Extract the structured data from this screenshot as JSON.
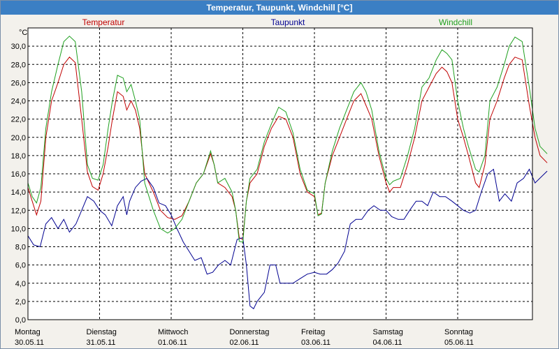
{
  "window": {
    "title": "Temperatur, Taupunkt, Windchill [°C]"
  },
  "chart_data": {
    "type": "line",
    "title": "Temperatur, Taupunkt, Windchill [°C]",
    "ylabel": "°C",
    "ylim": [
      0,
      32
    ],
    "yticks": [
      "0,0",
      "2,0",
      "4,0",
      "6,0",
      "8,0",
      "10,0",
      "12,0",
      "14,0",
      "16,0",
      "18,0",
      "20,0",
      "22,0",
      "24,0",
      "26,0",
      "28,0",
      "30,0"
    ],
    "xlim": [
      0,
      7
    ],
    "x_ticks": [
      {
        "day": "Montag",
        "date": "30.05.11",
        "x": 0
      },
      {
        "day": "Dienstag",
        "date": "31.05.11",
        "x": 1
      },
      {
        "day": "Mittwoch",
        "date": "01.06.11",
        "x": 2
      },
      {
        "day": "Donnerstag",
        "date": "02.06.11",
        "x": 3
      },
      {
        "day": "Freitag",
        "date": "03.06.11",
        "x": 4
      },
      {
        "day": "Samstag",
        "date": "04.06.11",
        "x": 5
      },
      {
        "day": "Sonntag",
        "date": "05.06.11",
        "x": 6
      }
    ],
    "grid": true,
    "legend_position": "top",
    "series": [
      {
        "name": "Temperatur",
        "color": "#c00000",
        "points": [
          [
            0,
            14.5
          ],
          [
            0.06,
            13.0
          ],
          [
            0.12,
            11.5
          ],
          [
            0.18,
            13.0
          ],
          [
            0.25,
            20
          ],
          [
            0.33,
            24
          ],
          [
            0.42,
            26
          ],
          [
            0.5,
            28
          ],
          [
            0.58,
            28.8
          ],
          [
            0.66,
            28.2
          ],
          [
            0.75,
            22
          ],
          [
            0.83,
            16.2
          ],
          [
            0.9,
            14.6
          ],
          [
            0.98,
            14.2
          ],
          [
            1.05,
            16
          ],
          [
            1.12,
            19
          ],
          [
            1.18,
            22
          ],
          [
            1.25,
            25
          ],
          [
            1.33,
            24.5
          ],
          [
            1.38,
            23
          ],
          [
            1.44,
            24
          ],
          [
            1.5,
            23
          ],
          [
            1.56,
            21
          ],
          [
            1.63,
            16
          ],
          [
            1.75,
            14
          ],
          [
            1.85,
            12
          ],
          [
            1.95,
            11.2
          ],
          [
            2.05,
            11
          ],
          [
            2.15,
            11.4
          ],
          [
            2.25,
            13
          ],
          [
            2.35,
            15
          ],
          [
            2.45,
            16
          ],
          [
            2.55,
            18.2
          ],
          [
            2.6,
            17
          ],
          [
            2.65,
            15
          ],
          [
            2.75,
            14.5
          ],
          [
            2.85,
            13.5
          ],
          [
            2.9,
            12
          ],
          [
            2.95,
            9.0
          ],
          [
            3.0,
            8.8
          ],
          [
            3.05,
            13
          ],
          [
            3.1,
            15
          ],
          [
            3.2,
            16
          ],
          [
            3.3,
            19
          ],
          [
            3.4,
            21
          ],
          [
            3.5,
            22.3
          ],
          [
            3.6,
            22
          ],
          [
            3.7,
            20
          ],
          [
            3.8,
            16
          ],
          [
            3.9,
            14
          ],
          [
            4.0,
            13.5
          ],
          [
            4.05,
            11.5
          ],
          [
            4.1,
            11.7
          ],
          [
            4.15,
            15
          ],
          [
            4.25,
            18
          ],
          [
            4.35,
            20
          ],
          [
            4.45,
            22
          ],
          [
            4.55,
            24
          ],
          [
            4.65,
            24.8
          ],
          [
            4.72,
            23.5
          ],
          [
            4.8,
            22
          ],
          [
            4.9,
            18
          ],
          [
            5.0,
            15
          ],
          [
            5.05,
            14
          ],
          [
            5.1,
            14.5
          ],
          [
            5.2,
            14.5
          ],
          [
            5.3,
            17
          ],
          [
            5.4,
            20
          ],
          [
            5.5,
            24
          ],
          [
            5.6,
            25.5
          ],
          [
            5.7,
            27
          ],
          [
            5.78,
            27.7
          ],
          [
            5.85,
            27.2
          ],
          [
            5.92,
            26
          ],
          [
            6.0,
            22
          ],
          [
            6.08,
            20
          ],
          [
            6.15,
            18
          ],
          [
            6.25,
            15
          ],
          [
            6.3,
            14.5
          ],
          [
            6.38,
            17
          ],
          [
            6.45,
            22
          ],
          [
            6.55,
            24
          ],
          [
            6.65,
            26.5
          ],
          [
            6.72,
            28
          ],
          [
            6.8,
            28.8
          ],
          [
            6.9,
            28.5
          ],
          [
            7.0,
            23.5
          ],
          [
            7.08,
            20
          ],
          [
            7.15,
            18
          ],
          [
            7.25,
            17.2
          ]
        ]
      },
      {
        "name": "Taupunkt",
        "color": "#000090",
        "points": [
          [
            0,
            9.2
          ],
          [
            0.08,
            8.2
          ],
          [
            0.17,
            8.0
          ],
          [
            0.25,
            10.5
          ],
          [
            0.33,
            11.2
          ],
          [
            0.42,
            10.0
          ],
          [
            0.5,
            11.0
          ],
          [
            0.58,
            9.6
          ],
          [
            0.67,
            10.5
          ],
          [
            0.75,
            12.0
          ],
          [
            0.83,
            13.5
          ],
          [
            0.92,
            13.0
          ],
          [
            1.0,
            12.0
          ],
          [
            1.08,
            11.5
          ],
          [
            1.17,
            10.3
          ],
          [
            1.25,
            12.5
          ],
          [
            1.33,
            13.5
          ],
          [
            1.38,
            11.5
          ],
          [
            1.42,
            13.0
          ],
          [
            1.5,
            14.5
          ],
          [
            1.58,
            15.2
          ],
          [
            1.66,
            15.5
          ],
          [
            1.75,
            14.5
          ],
          [
            1.83,
            12.8
          ],
          [
            1.92,
            12.5
          ],
          [
            2.0,
            11.5
          ],
          [
            2.08,
            10.0
          ],
          [
            2.17,
            8.5
          ],
          [
            2.25,
            7.5
          ],
          [
            2.33,
            6.5
          ],
          [
            2.42,
            6.8
          ],
          [
            2.5,
            5.0
          ],
          [
            2.58,
            5.2
          ],
          [
            2.66,
            6.0
          ],
          [
            2.75,
            6.5
          ],
          [
            2.83,
            6.0
          ],
          [
            2.92,
            8.8
          ],
          [
            3.0,
            9.0
          ],
          [
            3.05,
            6.0
          ],
          [
            3.1,
            1.5
          ],
          [
            3.15,
            1.2
          ],
          [
            3.2,
            2.0
          ],
          [
            3.3,
            3.0
          ],
          [
            3.38,
            6.0
          ],
          [
            3.46,
            6.0
          ],
          [
            3.52,
            4.0
          ],
          [
            3.6,
            4.0
          ],
          [
            3.7,
            4.0
          ],
          [
            3.8,
            4.5
          ],
          [
            3.9,
            5.0
          ],
          [
            4.0,
            5.2
          ],
          [
            4.08,
            5.0
          ],
          [
            4.17,
            5.0
          ],
          [
            4.25,
            5.5
          ],
          [
            4.33,
            6.2
          ],
          [
            4.42,
            7.5
          ],
          [
            4.5,
            10.5
          ],
          [
            4.58,
            11.0
          ],
          [
            4.66,
            11.0
          ],
          [
            4.75,
            12.0
          ],
          [
            4.83,
            12.5
          ],
          [
            4.92,
            12.0
          ],
          [
            5.0,
            12.0
          ],
          [
            5.08,
            11.3
          ],
          [
            5.17,
            11.0
          ],
          [
            5.25,
            11.0
          ],
          [
            5.33,
            12.0
          ],
          [
            5.42,
            13.0
          ],
          [
            5.5,
            13.0
          ],
          [
            5.58,
            12.5
          ],
          [
            5.66,
            14.0
          ],
          [
            5.75,
            13.5
          ],
          [
            5.83,
            13.5
          ],
          [
            5.92,
            13.0
          ],
          [
            6.0,
            12.5
          ],
          [
            6.08,
            12.0
          ],
          [
            6.17,
            11.7
          ],
          [
            6.25,
            12.0
          ],
          [
            6.33,
            14.0
          ],
          [
            6.42,
            16.0
          ],
          [
            6.5,
            16.5
          ],
          [
            6.58,
            13.0
          ],
          [
            6.66,
            13.8
          ],
          [
            6.75,
            13.0
          ],
          [
            6.83,
            15.0
          ],
          [
            6.92,
            15.5
          ],
          [
            7.0,
            16.5
          ],
          [
            7.08,
            15.0
          ],
          [
            7.25,
            16.3
          ]
        ]
      },
      {
        "name": "Windchill",
        "color": "#20a020",
        "points": [
          [
            0,
            15.0
          ],
          [
            0.06,
            13.5
          ],
          [
            0.12,
            12.8
          ],
          [
            0.18,
            14.5
          ],
          [
            0.25,
            21
          ],
          [
            0.33,
            25
          ],
          [
            0.42,
            28
          ],
          [
            0.5,
            30.5
          ],
          [
            0.58,
            31.1
          ],
          [
            0.66,
            30.5
          ],
          [
            0.75,
            25
          ],
          [
            0.83,
            17
          ],
          [
            0.9,
            15.5
          ],
          [
            0.98,
            15.3
          ],
          [
            1.05,
            17
          ],
          [
            1.12,
            21
          ],
          [
            1.18,
            24
          ],
          [
            1.25,
            26.8
          ],
          [
            1.33,
            26.5
          ],
          [
            1.38,
            25
          ],
          [
            1.44,
            25.8
          ],
          [
            1.5,
            24
          ],
          [
            1.56,
            22
          ],
          [
            1.63,
            15
          ],
          [
            1.75,
            12
          ],
          [
            1.85,
            10
          ],
          [
            1.95,
            9.5
          ],
          [
            2.05,
            10
          ],
          [
            2.15,
            11
          ],
          [
            2.25,
            13
          ],
          [
            2.35,
            15
          ],
          [
            2.45,
            16
          ],
          [
            2.55,
            18.5
          ],
          [
            2.6,
            17
          ],
          [
            2.65,
            15
          ],
          [
            2.75,
            15.5
          ],
          [
            2.85,
            14
          ],
          [
            2.9,
            12
          ],
          [
            2.95,
            8.6
          ],
          [
            3.0,
            8.5
          ],
          [
            3.05,
            13
          ],
          [
            3.1,
            15.5
          ],
          [
            3.2,
            16.5
          ],
          [
            3.3,
            19.5
          ],
          [
            3.4,
            21.5
          ],
          [
            3.5,
            23.3
          ],
          [
            3.6,
            22.8
          ],
          [
            3.7,
            20.5
          ],
          [
            3.8,
            16.5
          ],
          [
            3.9,
            14.2
          ],
          [
            4.0,
            13.8
          ],
          [
            4.05,
            11.4
          ],
          [
            4.1,
            11.6
          ],
          [
            4.15,
            15
          ],
          [
            4.25,
            18.5
          ],
          [
            4.35,
            21
          ],
          [
            4.45,
            23
          ],
          [
            4.55,
            25
          ],
          [
            4.65,
            26
          ],
          [
            4.72,
            25
          ],
          [
            4.8,
            23
          ],
          [
            4.9,
            18.5
          ],
          [
            5.0,
            15.5
          ],
          [
            5.05,
            14.8
          ],
          [
            5.1,
            15.2
          ],
          [
            5.2,
            15.5
          ],
          [
            5.3,
            18
          ],
          [
            5.4,
            21
          ],
          [
            5.5,
            25.5
          ],
          [
            5.6,
            26.5
          ],
          [
            5.7,
            28.5
          ],
          [
            5.78,
            29.6
          ],
          [
            5.85,
            29.2
          ],
          [
            5.92,
            28.5
          ],
          [
            6.0,
            24
          ],
          [
            6.08,
            21
          ],
          [
            6.15,
            19
          ],
          [
            6.25,
            16.5
          ],
          [
            6.3,
            16.2
          ],
          [
            6.38,
            18
          ],
          [
            6.45,
            24
          ],
          [
            6.55,
            25.5
          ],
          [
            6.65,
            28
          ],
          [
            6.72,
            30
          ],
          [
            6.8,
            31
          ],
          [
            6.9,
            30.5
          ],
          [
            7.0,
            25.5
          ],
          [
            7.08,
            21
          ],
          [
            7.15,
            19
          ],
          [
            7.25,
            18.2
          ]
        ]
      }
    ]
  }
}
